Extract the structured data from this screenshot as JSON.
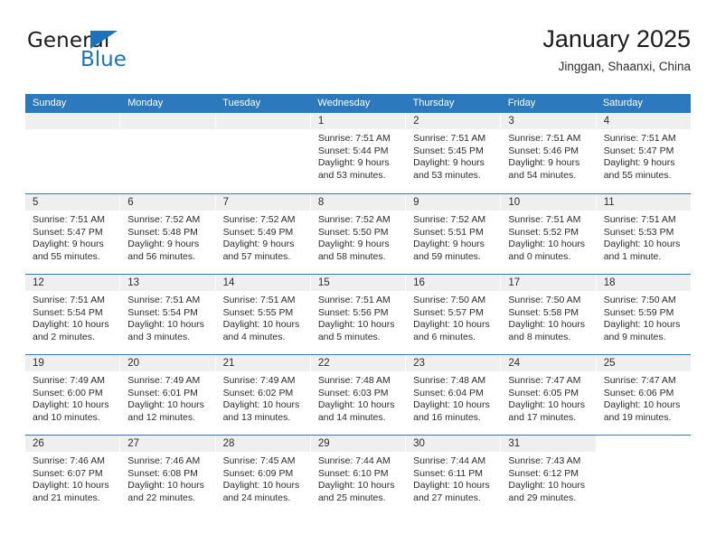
{
  "logo": {
    "text_primary": "General",
    "text_secondary": "Blue",
    "accent_color": "#1b74bb",
    "icon": "triangle-mark"
  },
  "header": {
    "title": "January 2025",
    "subtitle": "Jinggan, Shaanxi, China"
  },
  "theme": {
    "header_bar": "#2d79bd",
    "day_band": "#efefef",
    "text": "#2b2b2b"
  },
  "weekdays": [
    "Sunday",
    "Monday",
    "Tuesday",
    "Wednesday",
    "Thursday",
    "Friday",
    "Saturday"
  ],
  "weeks": [
    [
      {
        "empty": true
      },
      {
        "empty": true
      },
      {
        "empty": true
      },
      {
        "day": "1",
        "sunrise": "Sunrise: 7:51 AM",
        "sunset": "Sunset: 5:44 PM",
        "daylight1": "Daylight: 9 hours",
        "daylight2": "and 53 minutes."
      },
      {
        "day": "2",
        "sunrise": "Sunrise: 7:51 AM",
        "sunset": "Sunset: 5:45 PM",
        "daylight1": "Daylight: 9 hours",
        "daylight2": "and 53 minutes."
      },
      {
        "day": "3",
        "sunrise": "Sunrise: 7:51 AM",
        "sunset": "Sunset: 5:46 PM",
        "daylight1": "Daylight: 9 hours",
        "daylight2": "and 54 minutes."
      },
      {
        "day": "4",
        "sunrise": "Sunrise: 7:51 AM",
        "sunset": "Sunset: 5:47 PM",
        "daylight1": "Daylight: 9 hours",
        "daylight2": "and 55 minutes."
      }
    ],
    [
      {
        "day": "5",
        "sunrise": "Sunrise: 7:51 AM",
        "sunset": "Sunset: 5:47 PM",
        "daylight1": "Daylight: 9 hours",
        "daylight2": "and 55 minutes."
      },
      {
        "day": "6",
        "sunrise": "Sunrise: 7:52 AM",
        "sunset": "Sunset: 5:48 PM",
        "daylight1": "Daylight: 9 hours",
        "daylight2": "and 56 minutes."
      },
      {
        "day": "7",
        "sunrise": "Sunrise: 7:52 AM",
        "sunset": "Sunset: 5:49 PM",
        "daylight1": "Daylight: 9 hours",
        "daylight2": "and 57 minutes."
      },
      {
        "day": "8",
        "sunrise": "Sunrise: 7:52 AM",
        "sunset": "Sunset: 5:50 PM",
        "daylight1": "Daylight: 9 hours",
        "daylight2": "and 58 minutes."
      },
      {
        "day": "9",
        "sunrise": "Sunrise: 7:52 AM",
        "sunset": "Sunset: 5:51 PM",
        "daylight1": "Daylight: 9 hours",
        "daylight2": "and 59 minutes."
      },
      {
        "day": "10",
        "sunrise": "Sunrise: 7:51 AM",
        "sunset": "Sunset: 5:52 PM",
        "daylight1": "Daylight: 10 hours",
        "daylight2": "and 0 minutes."
      },
      {
        "day": "11",
        "sunrise": "Sunrise: 7:51 AM",
        "sunset": "Sunset: 5:53 PM",
        "daylight1": "Daylight: 10 hours",
        "daylight2": "and 1 minute."
      }
    ],
    [
      {
        "day": "12",
        "sunrise": "Sunrise: 7:51 AM",
        "sunset": "Sunset: 5:54 PM",
        "daylight1": "Daylight: 10 hours",
        "daylight2": "and 2 minutes."
      },
      {
        "day": "13",
        "sunrise": "Sunrise: 7:51 AM",
        "sunset": "Sunset: 5:54 PM",
        "daylight1": "Daylight: 10 hours",
        "daylight2": "and 3 minutes."
      },
      {
        "day": "14",
        "sunrise": "Sunrise: 7:51 AM",
        "sunset": "Sunset: 5:55 PM",
        "daylight1": "Daylight: 10 hours",
        "daylight2": "and 4 minutes."
      },
      {
        "day": "15",
        "sunrise": "Sunrise: 7:51 AM",
        "sunset": "Sunset: 5:56 PM",
        "daylight1": "Daylight: 10 hours",
        "daylight2": "and 5 minutes."
      },
      {
        "day": "16",
        "sunrise": "Sunrise: 7:50 AM",
        "sunset": "Sunset: 5:57 PM",
        "daylight1": "Daylight: 10 hours",
        "daylight2": "and 6 minutes."
      },
      {
        "day": "17",
        "sunrise": "Sunrise: 7:50 AM",
        "sunset": "Sunset: 5:58 PM",
        "daylight1": "Daylight: 10 hours",
        "daylight2": "and 8 minutes."
      },
      {
        "day": "18",
        "sunrise": "Sunrise: 7:50 AM",
        "sunset": "Sunset: 5:59 PM",
        "daylight1": "Daylight: 10 hours",
        "daylight2": "and 9 minutes."
      }
    ],
    [
      {
        "day": "19",
        "sunrise": "Sunrise: 7:49 AM",
        "sunset": "Sunset: 6:00 PM",
        "daylight1": "Daylight: 10 hours",
        "daylight2": "and 10 minutes."
      },
      {
        "day": "20",
        "sunrise": "Sunrise: 7:49 AM",
        "sunset": "Sunset: 6:01 PM",
        "daylight1": "Daylight: 10 hours",
        "daylight2": "and 12 minutes."
      },
      {
        "day": "21",
        "sunrise": "Sunrise: 7:49 AM",
        "sunset": "Sunset: 6:02 PM",
        "daylight1": "Daylight: 10 hours",
        "daylight2": "and 13 minutes."
      },
      {
        "day": "22",
        "sunrise": "Sunrise: 7:48 AM",
        "sunset": "Sunset: 6:03 PM",
        "daylight1": "Daylight: 10 hours",
        "daylight2": "and 14 minutes."
      },
      {
        "day": "23",
        "sunrise": "Sunrise: 7:48 AM",
        "sunset": "Sunset: 6:04 PM",
        "daylight1": "Daylight: 10 hours",
        "daylight2": "and 16 minutes."
      },
      {
        "day": "24",
        "sunrise": "Sunrise: 7:47 AM",
        "sunset": "Sunset: 6:05 PM",
        "daylight1": "Daylight: 10 hours",
        "daylight2": "and 17 minutes."
      },
      {
        "day": "25",
        "sunrise": "Sunrise: 7:47 AM",
        "sunset": "Sunset: 6:06 PM",
        "daylight1": "Daylight: 10 hours",
        "daylight2": "and 19 minutes."
      }
    ],
    [
      {
        "day": "26",
        "sunrise": "Sunrise: 7:46 AM",
        "sunset": "Sunset: 6:07 PM",
        "daylight1": "Daylight: 10 hours",
        "daylight2": "and 21 minutes."
      },
      {
        "day": "27",
        "sunrise": "Sunrise: 7:46 AM",
        "sunset": "Sunset: 6:08 PM",
        "daylight1": "Daylight: 10 hours",
        "daylight2": "and 22 minutes."
      },
      {
        "day": "28",
        "sunrise": "Sunrise: 7:45 AM",
        "sunset": "Sunset: 6:09 PM",
        "daylight1": "Daylight: 10 hours",
        "daylight2": "and 24 minutes."
      },
      {
        "day": "29",
        "sunrise": "Sunrise: 7:44 AM",
        "sunset": "Sunset: 6:10 PM",
        "daylight1": "Daylight: 10 hours",
        "daylight2": "and 25 minutes."
      },
      {
        "day": "30",
        "sunrise": "Sunrise: 7:44 AM",
        "sunset": "Sunset: 6:11 PM",
        "daylight1": "Daylight: 10 hours",
        "daylight2": "and 27 minutes."
      },
      {
        "day": "31",
        "sunrise": "Sunrise: 7:43 AM",
        "sunset": "Sunset: 6:12 PM",
        "daylight1": "Daylight: 10 hours",
        "daylight2": "and 29 minutes."
      },
      {
        "blank": true
      }
    ]
  ]
}
